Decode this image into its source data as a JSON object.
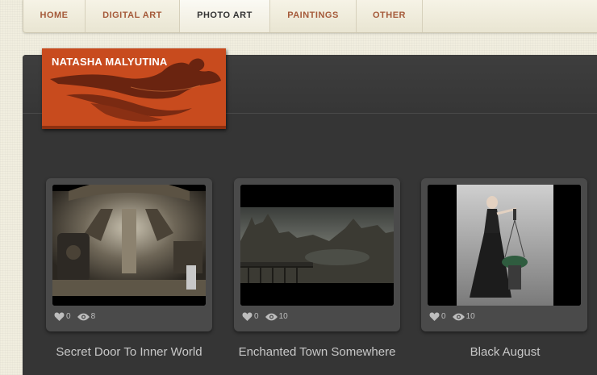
{
  "nav": {
    "items": [
      {
        "label": "HOME"
      },
      {
        "label": "DIGITAL ART"
      },
      {
        "label": "PHOTO ART"
      },
      {
        "label": "PAINTINGS"
      },
      {
        "label": "OTHER"
      }
    ],
    "active": "PHOTO ART"
  },
  "brand": {
    "name": "NATASHA MALYUTINA",
    "color": "#c84b1e"
  },
  "gallery": [
    {
      "title": "Secret Door To Inner World",
      "likes": "0",
      "views": "8"
    },
    {
      "title": "Enchanted Town Somewhere",
      "likes": "0",
      "views": "10"
    },
    {
      "title": "Black August",
      "likes": "0",
      "views": "10"
    }
  ],
  "icons": {
    "likes": "heart-icon",
    "views": "eye-icon"
  }
}
